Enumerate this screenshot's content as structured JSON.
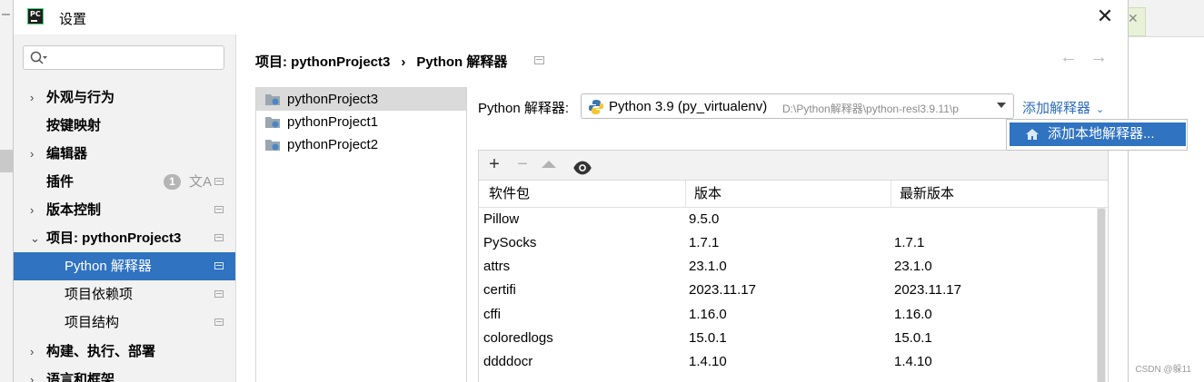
{
  "window": {
    "title": "设置",
    "close_glyph": "✕"
  },
  "background": {
    "watermark": "CSDN @躲11"
  },
  "search": {
    "placeholder": ""
  },
  "sidebar": {
    "items": [
      {
        "label": "外观与行为",
        "arrow": "›"
      },
      {
        "label": "按键映射"
      },
      {
        "label": "编辑器",
        "arrow": "›"
      },
      {
        "label": "插件",
        "badge": "1",
        "translate_glyph": "文A"
      },
      {
        "label": "版本控制",
        "arrow": "›"
      },
      {
        "label": "项目: pythonProject3",
        "arrow": "⌄"
      },
      {
        "label": "Python 解释器"
      },
      {
        "label": "项目依赖项"
      },
      {
        "label": "项目结构"
      },
      {
        "label": "构建、执行、部署",
        "arrow": "›"
      },
      {
        "label": "语言和框架",
        "arrow": "›"
      }
    ]
  },
  "breadcrumb": {
    "project": "项目: pythonProject3",
    "separator": "›",
    "page": "Python 解释器"
  },
  "nav": {
    "back": "←",
    "forward": "→"
  },
  "projects": [
    "pythonProject3",
    "pythonProject1",
    "pythonProject2"
  ],
  "interpreter": {
    "label": "Python 解释器:",
    "selected": "Python 3.9 (py_virtualenv)",
    "path": "D:\\Python解释器\\python-resl3.9.11\\p",
    "add_label": "添加解释器",
    "add_chevron": "⌄",
    "dropdown_item": "添加本地解释器..."
  },
  "packages": {
    "toolbar": {
      "add": "+",
      "remove": "−"
    },
    "columns": [
      "软件包",
      "版本",
      "最新版本"
    ],
    "rows": [
      [
        "Pillow",
        "9.5.0",
        ""
      ],
      [
        "PySocks",
        "1.7.1",
        "1.7.1"
      ],
      [
        "attrs",
        "23.1.0",
        "23.1.0"
      ],
      [
        "certifi",
        "2023.11.17",
        "2023.11.17"
      ],
      [
        "cffi",
        "1.16.0",
        "1.16.0"
      ],
      [
        "coloredlogs",
        "15.0.1",
        "15.0.1"
      ],
      [
        "ddddocr",
        "1.4.10",
        "1.4.10"
      ],
      [
        "",
        "",
        ""
      ]
    ]
  },
  "colors": {
    "accent": "#2f73c1",
    "link": "#2f6dbf",
    "sidebar_bg": "#f2f2f2"
  }
}
